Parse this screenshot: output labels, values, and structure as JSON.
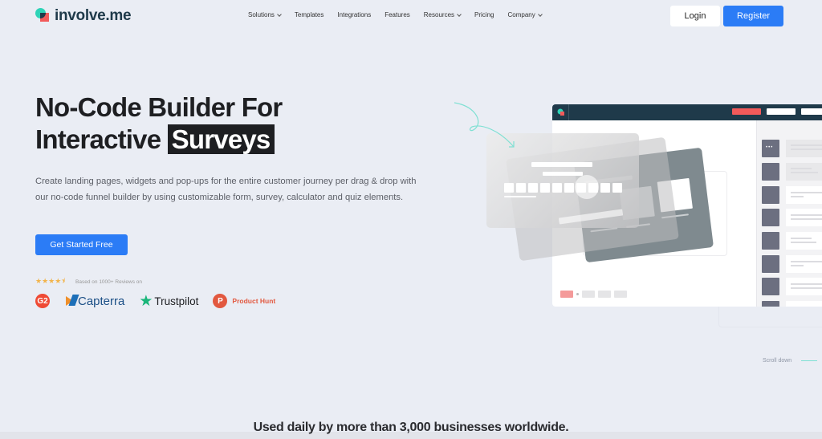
{
  "header": {
    "logo_text": "involve.me",
    "nav": [
      {
        "label": "Solutions",
        "has_dropdown": true
      },
      {
        "label": "Templates",
        "has_dropdown": false
      },
      {
        "label": "Integrations",
        "has_dropdown": false
      },
      {
        "label": "Features",
        "has_dropdown": false
      },
      {
        "label": "Resources",
        "has_dropdown": true
      },
      {
        "label": "Pricing",
        "has_dropdown": false
      },
      {
        "label": "Company",
        "has_dropdown": true
      }
    ],
    "login_label": "Login",
    "register_label": "Register"
  },
  "hero": {
    "title_line1": "No-Code Builder For",
    "title_line2_prefix": "Interactive",
    "title_highlight": "Surveys",
    "description": "Create landing pages, widgets and pop-ups for the entire customer journey per drag & drop with our no-code funnel builder by using customizable form, survey, calculator and quiz elements.",
    "cta_label": "Get Started Free",
    "rating": {
      "stars": 4.5,
      "stars_glyph": "★★★★⯨",
      "text": "Based on 1000+ Reviews on"
    },
    "review_sites": {
      "g2": "G2",
      "capterra": "Capterra",
      "trustpilot": "Trustpilot",
      "producthunt_mark": "P",
      "producthunt": "Product Hunt"
    }
  },
  "illustration": {
    "bar_colors": {
      "primary": "#f25a5a",
      "secondary": "#ffffff"
    }
  },
  "scroll_down_label": "Scroll down",
  "social_proof": "Used daily by more than 3,000 businesses worldwide.",
  "colors": {
    "background": "#eaedf4",
    "accent": "#2b7cf6",
    "brand_dark": "#1f3a4a",
    "brand_teal": "#2ed3b7",
    "brand_red": "#f25a5a"
  }
}
